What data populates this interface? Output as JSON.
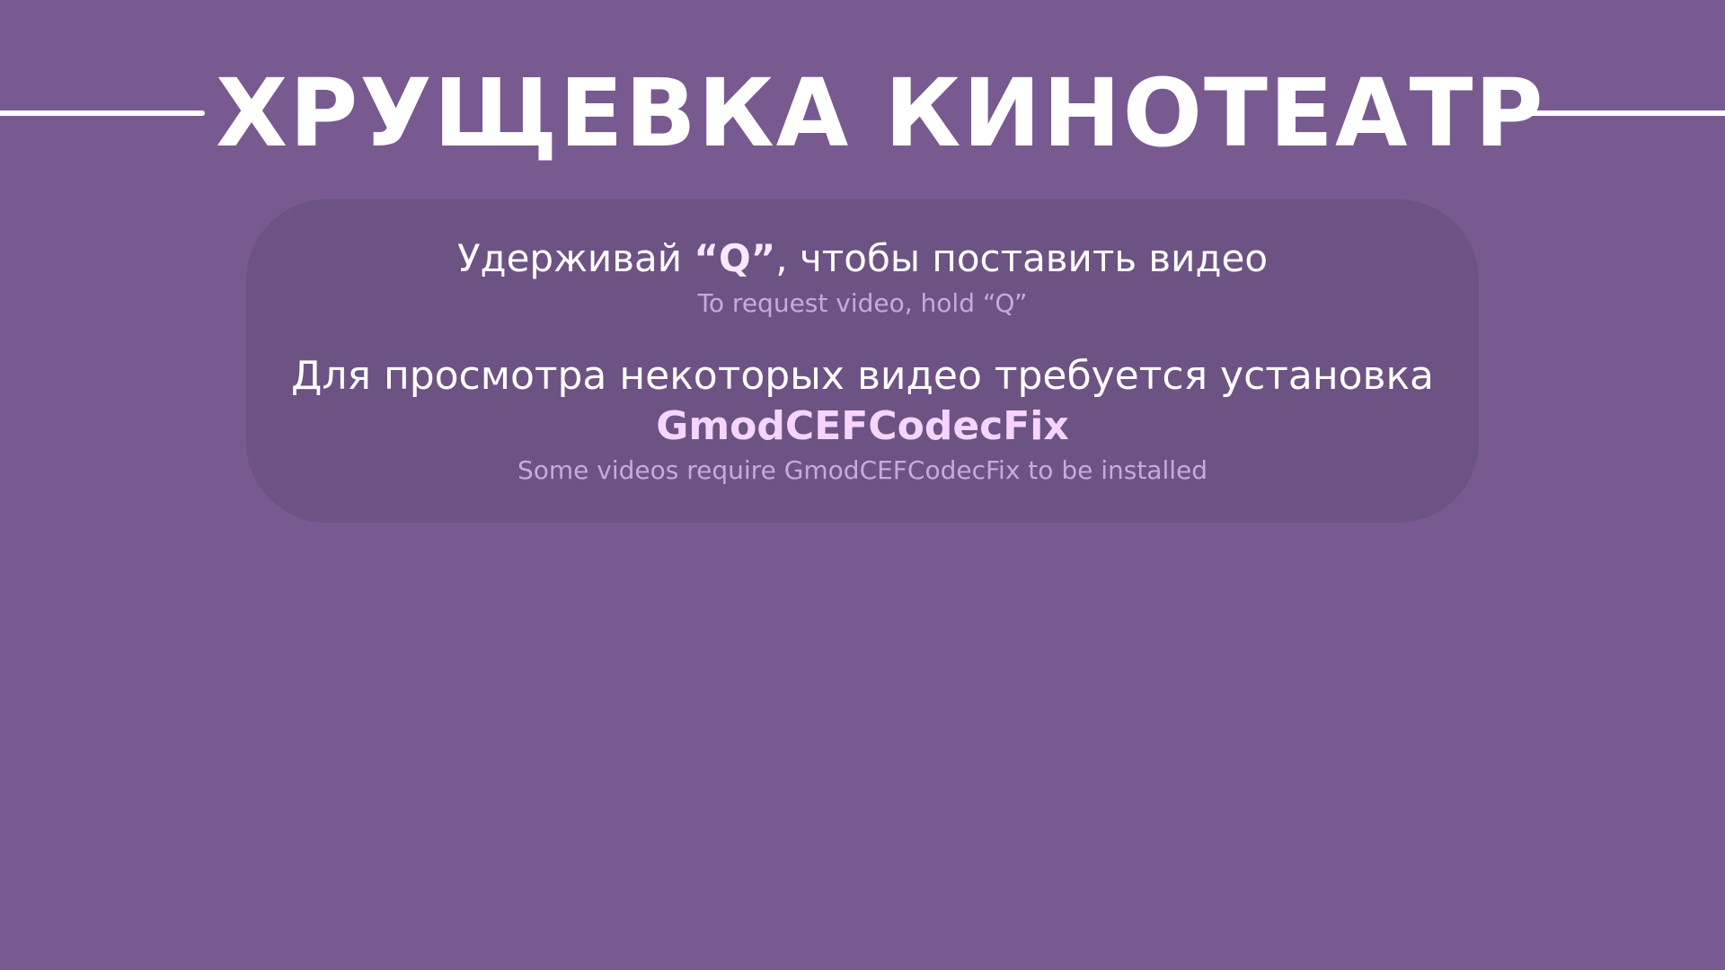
{
  "header": {
    "title": "ХРУЩЕВКА КИНОТЕАТР"
  },
  "request_hint": {
    "prefix": "Удерживай ",
    "key": "“Q”",
    "suffix": ", чтобы поставить видео",
    "translation": "To request video, hold “Q”"
  },
  "codec_notice": {
    "text": "Для просмотра некоторых видео требуется установка",
    "codec_name": "GmodCEFCodecFix",
    "translation": "Some videos require GmodCEFCodecFix to be installed"
  },
  "colors": {
    "background": "#785a91",
    "panel": "#6c5383",
    "highlight": "#f6d4ff",
    "secondary_text": "#c7aadc"
  }
}
